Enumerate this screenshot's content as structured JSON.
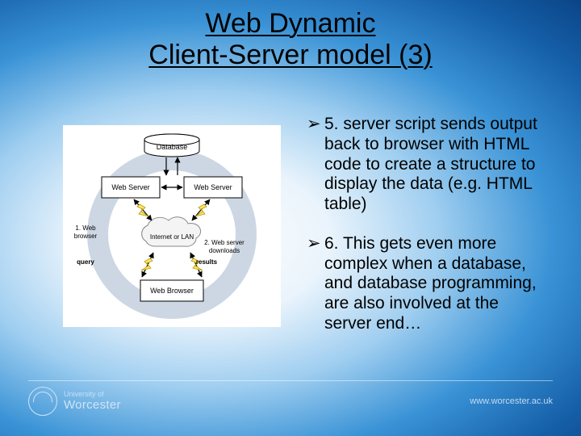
{
  "title": {
    "line1": "Web Dynamic",
    "line2": "Client-Server model (3)"
  },
  "bullets": [
    {
      "marker": "➢",
      "text": "5. server script sends output back to browser with HTML code to create a structure to display the data (e.g. HTML table)"
    },
    {
      "marker": "➢",
      "text": "6. This gets even more complex when a database, and database programming, are also involved at the server end…"
    }
  ],
  "diagram": {
    "database": "Database",
    "web_server_left": "Web Server",
    "web_server_right": "Web Server",
    "cloud": "Internet or LAN",
    "web_browser": "Web Browser",
    "side_left_1": "1. Web",
    "side_left_2": "browser",
    "side_left_3": "query",
    "side_right_1": "2. Web server",
    "side_right_2": "downloads",
    "side_right_3": "results"
  },
  "footer": {
    "uni_small": "University of",
    "uni_big": "Worcester",
    "url": "www.worcester.ac.uk"
  }
}
